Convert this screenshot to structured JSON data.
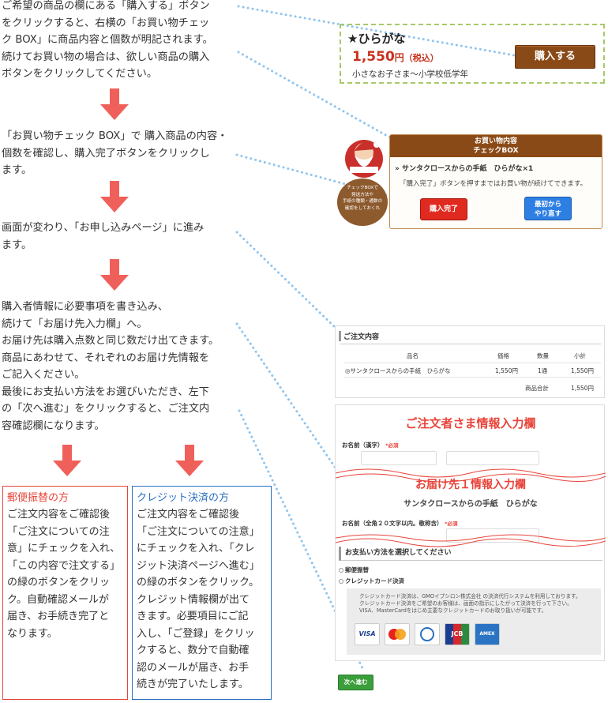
{
  "steps": [
    {
      "text": "ご希望の商品の欄にある「購入する」ボタン\nをクリックすると、右横の「お買い物チェッ\nク BOX」に商品内容と個数が明記されます。\n続けてお買い物の場合は、欲しい商品の購入\nボタンをクリックしてください。"
    },
    {
      "text": "「お買い物チェック BOX」で 購入商品の内容・\n個数を確認し、購入完了ボタンをクリックし\nます。"
    },
    {
      "text": "画面が変わり、「お申し込みページ」に進み\nます。"
    },
    {
      "text": "購入者情報に必要事項を書き込み、\n続けて「お届け先入力欄」へ。\nお届け先は購入点数と同じ数だけ出てきます。\n商品にあわせて、それぞれのお届け先情報を\nご記入ください。\n最後にお支払い方法をお選びいただき、左下\nの「次へ進む」をクリックすると、ご注文内\n容確認欄になります。"
    }
  ],
  "methods": [
    {
      "title": "郵便振替の方",
      "body": "ご注文内容をご確認後\n「ご注文についての注\n意」にチェックを入れ、\n「この内容で注文する」\nの緑のボタンをクリッ\nク。自動確認メールが\n届き、お手続き完了と\nなります。",
      "color": "#e8443a"
    },
    {
      "title": "クレジット決済の方",
      "body": "ご注文内容をご確認後\n「ご注文についての注意」\nにチェックを入れ、「クレ\nジット決済ページへ進む」\nの緑のボタンをクリック。\nクレジット情報欄が出て\nきます。必要項目にご記\n入し、「ご登録」をクリッ\nクすると、数分で自動確\n認のメールが届き、お手\n続きが完了いたします。",
      "color": "#2a6fc0"
    }
  ],
  "product": {
    "name": "★ひらがな",
    "price": "1,550",
    "price_unit": "円",
    "tax": "（税込）",
    "desc": "小さなお子さま〜小学校低学年",
    "buy_label": "購入する"
  },
  "check_box": {
    "title_line1": "お買い物内容",
    "title_line2": "チェックBOX",
    "item": "サンタクロースからの手紙　ひらがな×1",
    "note": "「購入完了」ボタンを押すまではお買い物が続けてできます。",
    "complete_label": "購入完了",
    "restart_line1": "最初から",
    "restart_line2": "やり直す",
    "santa_bubble": "チェックBOXで\n発送方法や\n手紙の種類・通数の\n確認をしておくれ"
  },
  "order": {
    "title": "ご注文内容",
    "headers": [
      "品名",
      "価格",
      "数量",
      "小計"
    ],
    "row": [
      "◎サンタクロースからの手紙　ひらがな",
      "1,550円",
      "1通",
      "1,550円"
    ],
    "total_label": "商品合計",
    "total_value": "1,550円"
  },
  "form": {
    "title": "ご注文者さま情報入力欄",
    "name_label": "お名前（漢字）",
    "required": "*必須",
    "delivery_title": "お届け先１情報入力欄",
    "delivery_product": "サンタクロースからの手紙　ひらがな",
    "delivery_name_label": "お名前（全角２０文字以内。敬称含）",
    "pay_title": "お支払い方法を選択してください",
    "pay_option1": "郵便振替",
    "pay_option2": "クレジットカード決済",
    "credit_text": "クレジットカード決済は、GMOイプシロン株式会社 の決済代行システムを利用しております。\nクレジットカード決済をご希望のお客様は、画面の指示にしたがって決済を行って下さい。\nVISA、MasterCardをはじめ主要なクレジットカードのお取り扱いが可能です。",
    "cards": [
      "VISA",
      "Master",
      "Diners",
      "JCB",
      "AMEX"
    ],
    "next_label": "次へ進む"
  },
  "colors": {
    "arrow": "#f0605a",
    "accent_red": "#e8443a",
    "brown": "#8a4a17",
    "dots": "#8ec5f0"
  }
}
